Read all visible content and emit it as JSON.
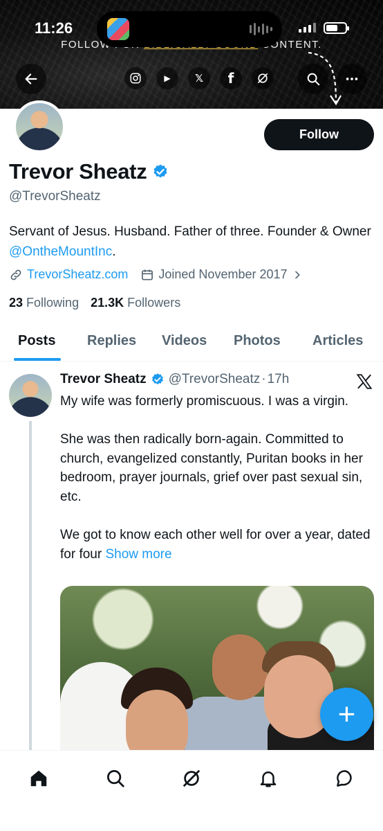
{
  "status_bar": {
    "time": "11:26"
  },
  "banner": {
    "text_before": "FOLLOW FOR ",
    "text_highlight": "BIBLICALLY SOUND",
    "text_after": " CONTENT."
  },
  "header_icons": [
    "back-arrow-icon",
    "instagram-icon",
    "youtube-icon",
    "x-icon",
    "facebook-icon",
    "grok-icon",
    "search-icon",
    "more-icon"
  ],
  "social_labels": {
    "youtube": "▶",
    "x": "𝕏",
    "facebook": "f"
  },
  "profile": {
    "name": "Trevor Sheatz",
    "handle": "@TrevorSheatz",
    "bio_text": "Servant of Jesus. Husband. Father of three. Founder & Owner ",
    "bio_mention": "@OntheMountInc",
    "bio_end": ".",
    "website": "TrevorSheatz.com",
    "joined": "Joined November 2017",
    "following_count": "23",
    "following_label": "Following",
    "followers_count": "21.3K",
    "followers_label": "Followers",
    "follow_button": "Follow"
  },
  "tabs": [
    "Posts",
    "Replies",
    "Videos",
    "Photos",
    "Articles"
  ],
  "active_tab": "Posts",
  "post": {
    "author": "Trevor Sheatz",
    "handle": "@TrevorSheatz",
    "separator": "·",
    "time": "17h",
    "text": "My wife was formerly promiscuous. I was a virgin.\n\nShe was then radically born-again. Committed to church, evangelized constantly, Puritan books in her bedroom, prayer journals, grief over past sexual sin, etc.\n\nWe got to know each other well for over a year, dated for four ",
    "show_more": "Show more"
  },
  "fab": {
    "label": "+"
  },
  "colors": {
    "accent": "#1d9bf0",
    "text": "#0f1419",
    "secondary": "#536471",
    "banner_highlight": "#f6c940"
  }
}
